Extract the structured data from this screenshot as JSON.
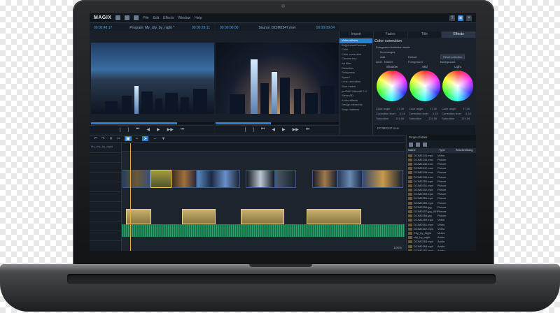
{
  "app": {
    "logo": "MAGIX",
    "menu": [
      "File",
      "Edit",
      "Effects",
      "Window",
      "Help"
    ],
    "window_controls": [
      "?",
      "▣",
      "×"
    ]
  },
  "program_monitor": {
    "timecode_left": "00:02:48:17",
    "title": "Program: My_city_by_night *",
    "timecode_right": "00:00:29:11"
  },
  "source_monitor": {
    "timecode_left": "00:00:00:00",
    "title": "Source: DCIM2247.mov",
    "timecode_right": "00:00:09:04"
  },
  "transport_icons": [
    "[",
    "]",
    "⏮",
    "◀",
    "▶",
    "▶▶",
    "⏭"
  ],
  "effects_panel": {
    "tabs": [
      "Import",
      "Fades",
      "Title",
      "Effects"
    ],
    "active_tab": "Effects",
    "list": [
      "Video effects",
      "Brightness/Contrast",
      "Color",
      "Color correction",
      "Chroma key",
      "Art filter",
      "Distortion",
      "Sharpness",
      "Speed",
      "Lens correction",
      "Shot match",
      "proDAD Mercalli 2.0",
      "Stereo3D",
      "Audio effects",
      "Design elements",
      "Snap markers"
    ],
    "selected": "Video effects",
    "title": "Color correction",
    "mode_label": "Foreground selection mode",
    "no_changes": "No changes",
    "add": "Add",
    "extract": "Extract",
    "reset": "Reset selection",
    "limit": "Limit",
    "options": [
      "Master",
      "Foreground",
      "Background"
    ],
    "wheels": [
      {
        "name": "Shadow",
        "angle_label": "Color angle",
        "angle": "17.39",
        "level_label": "Correction level",
        "level": "0.16",
        "sat_label": "Saturation",
        "sat": "124.56"
      },
      {
        "name": "Mid",
        "angle_label": "Color angle",
        "angle": "17.39",
        "level_label": "Correction level",
        "level": "0.15",
        "sat_label": "Saturation",
        "sat": "124.56"
      },
      {
        "name": "Light",
        "angle_label": "Color angle",
        "angle": "17.39",
        "level_label": "Correction level",
        "level": "0.16",
        "sat_label": "Saturation",
        "sat": "124.56"
      }
    ],
    "source_clip": "DCIM2247.mov"
  },
  "timeline": {
    "project": "My_city_by_night",
    "zoom": "100%"
  },
  "project_folder": {
    "title": "Project folder",
    "columns": [
      "Name",
      "Type",
      "Beschreibung"
    ],
    "items": [
      {
        "name": "DCIM2243.mp4",
        "type": "Video"
      },
      {
        "name": "DCIM2245.mov",
        "type": "Picture"
      },
      {
        "name": "DCIM2246.mov",
        "type": "Picture"
      },
      {
        "name": "DCIM2247.mov",
        "type": "Picture"
      },
      {
        "name": "DCIM2248.mov",
        "type": "Picture"
      },
      {
        "name": "DCIM2249.mov",
        "type": "Picture"
      },
      {
        "name": "DCIM2250.mp4",
        "type": "Picture"
      },
      {
        "name": "DCIM2251.mp4",
        "type": "Picture"
      },
      {
        "name": "DCIM2252.mp4",
        "type": "Picture"
      },
      {
        "name": "DCIM2253.mp4",
        "type": "Picture"
      },
      {
        "name": "DCIM2254.mp4",
        "type": "Picture"
      },
      {
        "name": "DCIM2255.mp4",
        "type": "Picture"
      },
      {
        "name": "DCIM2256.jpg",
        "type": "Picture"
      },
      {
        "name": "DCIM2257.jpg_001",
        "type": "Picture"
      },
      {
        "name": "DCIM2258.jpg",
        "type": "Picture"
      },
      {
        "name": "DCIM2259.mp4",
        "type": "Video"
      },
      {
        "name": "DCIM2261.mp4",
        "type": "Video"
      },
      {
        "name": "DCIM2262.mp4",
        "type": "Video"
      },
      {
        "name": "City_by_Night",
        "type": "Movie"
      },
      {
        "name": "city_by_night",
        "type": "Audio"
      },
      {
        "name": "DCIM2263.mp4",
        "type": "Audio"
      },
      {
        "name": "DCIM2264.mp4",
        "type": "Audio"
      },
      {
        "name": "DCIM2265.mp4",
        "type": "Audio"
      },
      {
        "name": "voice.wav",
        "type": "Audio"
      }
    ]
  }
}
